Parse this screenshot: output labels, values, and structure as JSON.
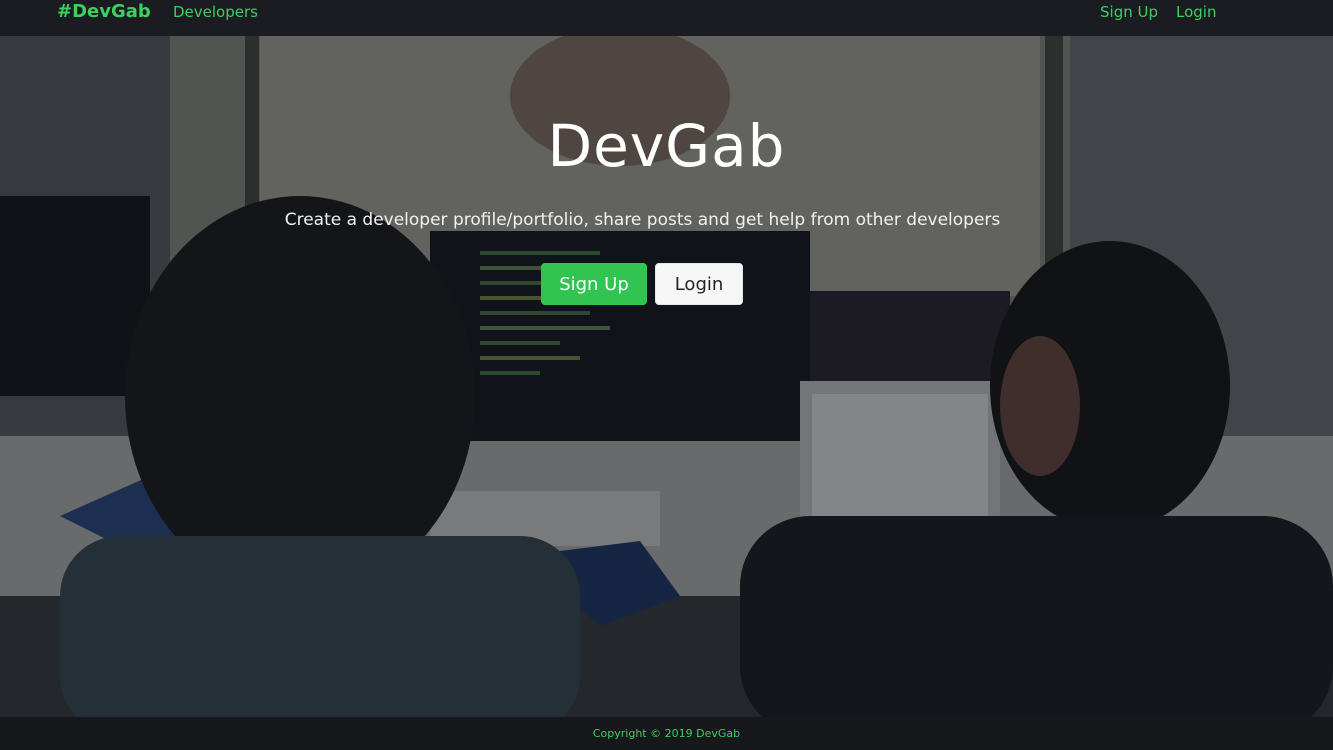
{
  "navbar": {
    "brand": "#DevGab",
    "links": {
      "developers": "Developers",
      "signup": "Sign Up",
      "login": "Login"
    }
  },
  "hero": {
    "title": "DevGab",
    "lead": "Create a developer profile/portfolio, share posts and get help from other developers",
    "buttons": {
      "signup": "Sign Up",
      "login": "Login"
    }
  },
  "footer": {
    "copyright": "Copyright © 2019 DevGab"
  },
  "colors": {
    "accent": "#3ecf5e",
    "signup_button": "#31c451",
    "navbar_bg": "#1a1c21"
  }
}
